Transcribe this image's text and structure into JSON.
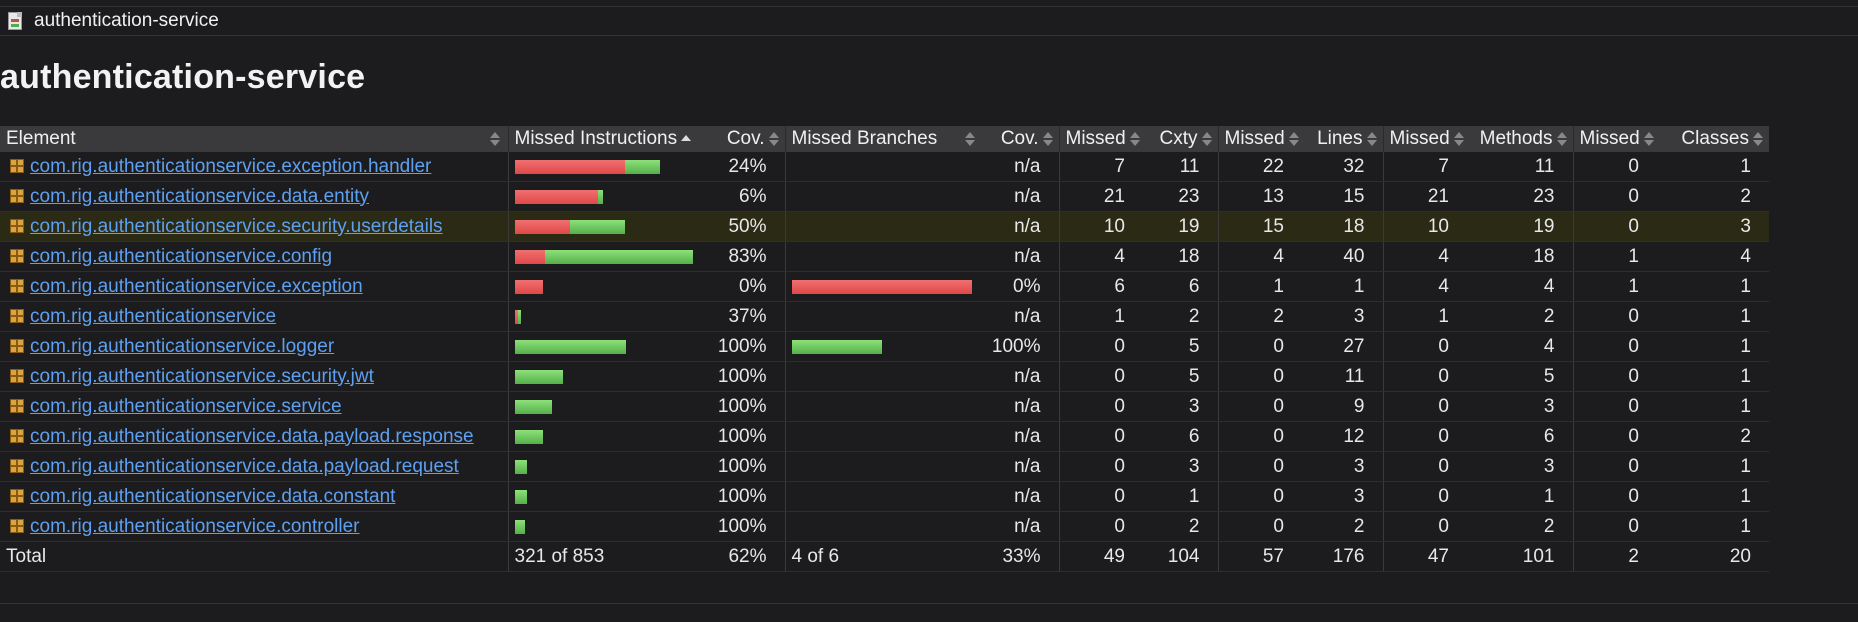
{
  "breadcrumb": {
    "icon": "session-report-icon",
    "label": "authentication-service"
  },
  "page_title": "authentication-service",
  "headers": [
    "Element",
    "Missed Instructions",
    "Cov.",
    "Missed Branches",
    "Cov.",
    "Missed",
    "Cxty",
    "Missed",
    "Lines",
    "Missed",
    "Methods",
    "Missed",
    "Classes"
  ],
  "rows": [
    {
      "name": "com.rig.authenticationservice.exception.handler",
      "instr": [
        110,
        35
      ],
      "icov": "24%",
      "branch": null,
      "bcov": "n/a",
      "mc": "7",
      "cx": "11",
      "ml": "22",
      "li": "32",
      "mm": "7",
      "me": "11",
      "mcl": "0",
      "cl": "1"
    },
    {
      "name": "com.rig.authenticationservice.data.entity",
      "instr": [
        83,
        5
      ],
      "icov": "6%",
      "branch": null,
      "bcov": "n/a",
      "mc": "21",
      "cx": "23",
      "ml": "13",
      "li": "15",
      "mm": "21",
      "me": "23",
      "mcl": "0",
      "cl": "2"
    },
    {
      "name": "com.rig.authenticationservice.security.userdetails",
      "instr": [
        55,
        55
      ],
      "icov": "50%",
      "branch": null,
      "bcov": "n/a",
      "mc": "10",
      "cx": "19",
      "ml": "15",
      "li": "18",
      "mm": "10",
      "me": "19",
      "mcl": "0",
      "cl": "3"
    },
    {
      "name": "com.rig.authenticationservice.config",
      "instr": [
        30,
        148
      ],
      "icov": "83%",
      "branch": null,
      "bcov": "n/a",
      "mc": "4",
      "cx": "18",
      "ml": "4",
      "li": "40",
      "mm": "4",
      "me": "18",
      "mcl": "1",
      "cl": "4"
    },
    {
      "name": "com.rig.authenticationservice.exception",
      "instr": [
        28,
        0
      ],
      "icov": "0%",
      "branch": [
        180,
        0
      ],
      "bcov": "0%",
      "mc": "6",
      "cx": "6",
      "ml": "1",
      "li": "1",
      "mm": "4",
      "me": "4",
      "mcl": "1",
      "cl": "1"
    },
    {
      "name": "com.rig.authenticationservice",
      "instr": [
        3,
        3
      ],
      "icov": "37%",
      "branch": null,
      "bcov": "n/a",
      "mc": "1",
      "cx": "2",
      "ml": "2",
      "li": "3",
      "mm": "1",
      "me": "2",
      "mcl": "0",
      "cl": "1"
    },
    {
      "name": "com.rig.authenticationservice.logger",
      "instr": [
        0,
        111
      ],
      "icov": "100%",
      "branch": [
        0,
        90
      ],
      "bcov": "100%",
      "mc": "0",
      "cx": "5",
      "ml": "0",
      "li": "27",
      "mm": "0",
      "me": "4",
      "mcl": "0",
      "cl": "1"
    },
    {
      "name": "com.rig.authenticationservice.security.jwt",
      "instr": [
        0,
        48
      ],
      "icov": "100%",
      "branch": null,
      "bcov": "n/a",
      "mc": "0",
      "cx": "5",
      "ml": "0",
      "li": "11",
      "mm": "0",
      "me": "5",
      "mcl": "0",
      "cl": "1"
    },
    {
      "name": "com.rig.authenticationservice.service",
      "instr": [
        0,
        37
      ],
      "icov": "100%",
      "branch": null,
      "bcov": "n/a",
      "mc": "0",
      "cx": "3",
      "ml": "0",
      "li": "9",
      "mm": "0",
      "me": "3",
      "mcl": "0",
      "cl": "1"
    },
    {
      "name": "com.rig.authenticationservice.data.payload.response",
      "instr": [
        0,
        28
      ],
      "icov": "100%",
      "branch": null,
      "bcov": "n/a",
      "mc": "0",
      "cx": "6",
      "ml": "0",
      "li": "12",
      "mm": "0",
      "me": "6",
      "mcl": "0",
      "cl": "2"
    },
    {
      "name": "com.rig.authenticationservice.data.payload.request",
      "instr": [
        0,
        12
      ],
      "icov": "100%",
      "branch": null,
      "bcov": "n/a",
      "mc": "0",
      "cx": "3",
      "ml": "0",
      "li": "3",
      "mm": "0",
      "me": "3",
      "mcl": "0",
      "cl": "1"
    },
    {
      "name": "com.rig.authenticationservice.data.constant",
      "instr": [
        0,
        12
      ],
      "icov": "100%",
      "branch": null,
      "bcov": "n/a",
      "mc": "0",
      "cx": "1",
      "ml": "0",
      "li": "3",
      "mm": "0",
      "me": "1",
      "mcl": "0",
      "cl": "1"
    },
    {
      "name": "com.rig.authenticationservice.controller",
      "instr": [
        0,
        10
      ],
      "icov": "100%",
      "branch": null,
      "bcov": "n/a",
      "mc": "0",
      "cx": "2",
      "ml": "0",
      "li": "2",
      "mm": "0",
      "me": "2",
      "mcl": "0",
      "cl": "1"
    }
  ],
  "total": {
    "label": "Total",
    "instr": "321 of 853",
    "icov": "62%",
    "branch": "4 of 6",
    "bcov": "33%",
    "mc": "49",
    "cx": "104",
    "ml": "57",
    "li": "176",
    "mm": "47",
    "me": "101",
    "mcl": "2",
    "cl": "20"
  },
  "colors": {
    "missed": "#e04848",
    "covered": "#55b04a",
    "link": "#5ea0f0",
    "highlight_row": "#2b2a14"
  }
}
